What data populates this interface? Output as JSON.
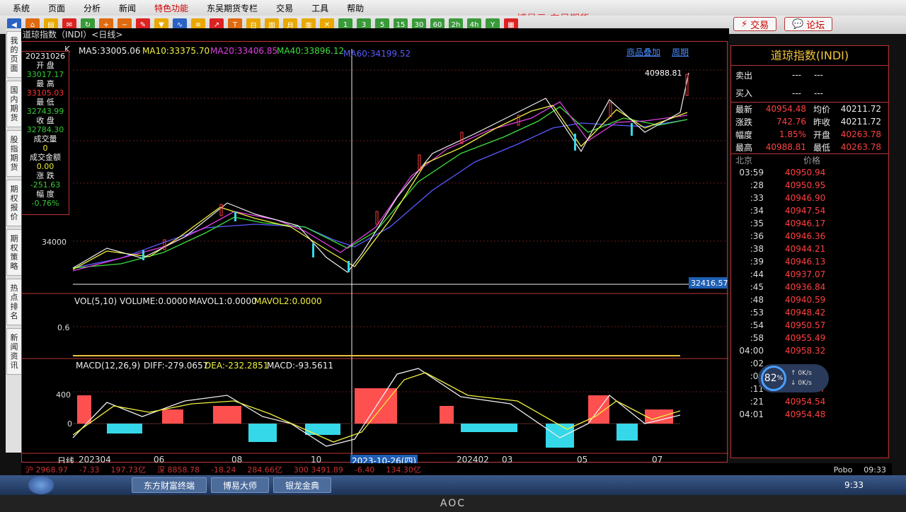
{
  "menu": {
    "items": [
      "系统",
      "页面",
      "分析",
      "新闻",
      "特色功能",
      "东吴期货专栏",
      "交易",
      "工具",
      "帮助"
    ],
    "highlight_index": 4
  },
  "brand": "博易云-东吴期货",
  "header_buttons": {
    "trade": "交易",
    "forum": "论坛"
  },
  "side_tabs": [
    "我的页面",
    "国内期货",
    "股指期货",
    "期权报价",
    "期权策略",
    "热点排名",
    "新闻资讯"
  ],
  "chart_title": "道琼指数（INDI）<日线>",
  "price_panel": {
    "date": "20231026",
    "fields": [
      {
        "label": "开 盘",
        "value": "33017.17",
        "color": "g"
      },
      {
        "label": "最 高",
        "value": "33105.03",
        "color": "r"
      },
      {
        "label": "最 低",
        "value": "32743.99",
        "color": "g"
      },
      {
        "label": "收 盘",
        "value": "32784.30",
        "color": "g"
      },
      {
        "label": "成交量",
        "value": "0",
        "color": "y"
      },
      {
        "label": "成交金额",
        "value": "0.00",
        "color": "y"
      },
      {
        "label": "涨 跌",
        "value": "-251.63",
        "color": "g"
      },
      {
        "label": "幅 度",
        "value": "-0.76%",
        "color": "g"
      }
    ]
  },
  "ma_legend": {
    "k": "K",
    "ma5": "MA5:33005.06",
    "ma10": "MA10:33375.70",
    "ma20": "MA20:33406.85",
    "ma40": "MA40:33896.12",
    "ma60": "MA60:34199.52",
    "overlay_link": "商品叠加",
    "period_link": "周期"
  },
  "price_labels": {
    "max": "40988.81",
    "crosshair_value": "32416.57",
    "y_tick": "34000"
  },
  "volume": {
    "legend": "VOL(5,10) VOLUME:0.0000",
    "mavol1": "MAVOL1:0.0000",
    "mavol2": "MAVOL2:0.0000",
    "y_tick": "0.6"
  },
  "macd": {
    "legend": "MACD(12,26,9)",
    "diff": "DIFF:-279.0657",
    "dea": "DEA:-232.2851",
    "macd": "MACD:-93.5611",
    "y_ticks": [
      "400",
      "0"
    ]
  },
  "x_axis": {
    "label": "日线",
    "ticks": [
      "202304",
      "06",
      "08",
      "10",
      "2023-10-26(四)",
      "202402",
      "03",
      "05",
      "07"
    ]
  },
  "right_panel": {
    "title": "道琼指数(INDI)",
    "sell_label": "卖出",
    "buy_label": "买入",
    "empty": "---",
    "stats": [
      {
        "l1": "最新",
        "v1": "40954.48",
        "l2": "均价",
        "v2": "40211.72"
      },
      {
        "l1": "涨跌",
        "v1": "742.76",
        "l2": "昨收",
        "v2": "40211.72"
      },
      {
        "l1": "幅度",
        "v1": "1.85%",
        "l2": "开盘",
        "v2": "40263.78"
      },
      {
        "l1": "最高",
        "v1": "40988.81",
        "l2": "最低",
        "v2": "40263.78"
      }
    ],
    "tick_header": {
      "city": "北京",
      "price": "价格"
    },
    "ticks": [
      {
        "t": "03:59",
        "p": "40950.94"
      },
      {
        "t": ":28",
        "p": "40950.95"
      },
      {
        "t": ":33",
        "p": "40946.90"
      },
      {
        "t": ":34",
        "p": "40947.54"
      },
      {
        "t": ":35",
        "p": "40946.17"
      },
      {
        "t": ":36",
        "p": "40946.36"
      },
      {
        "t": ":38",
        "p": "40944.21"
      },
      {
        "t": ":39",
        "p": "40946.13"
      },
      {
        "t": ":44",
        "p": "40937.07"
      },
      {
        "t": ":45",
        "p": "40936.84"
      },
      {
        "t": ":48",
        "p": "40940.59"
      },
      {
        "t": ":53",
        "p": "40948.42"
      },
      {
        "t": ":54",
        "p": "40950.57"
      },
      {
        "t": ":58",
        "p": "40955.49"
      },
      {
        "t": "04:00",
        "p": "40958.32"
      },
      {
        "t": ":02",
        "p": ""
      },
      {
        "t": ":03",
        "p": ""
      },
      {
        "t": ":11",
        "p": "40955.07"
      },
      {
        "t": ":21",
        "p": "40954.54"
      },
      {
        "t": "04:01",
        "p": "40954.48"
      }
    ],
    "net_widget": {
      "percent": "82",
      "unit": "%",
      "up": "0K/s",
      "down": "0K/s"
    }
  },
  "status_bar": [
    "沪 2968.97",
    "-7.33",
    "197.73亿",
    "深 8858.78",
    "-18.24",
    "284.66亿",
    "300 3491.89",
    "-6.40",
    "134.30亿"
  ],
  "pobo": "Pobo",
  "clock": "09:33",
  "taskbar": {
    "items": [
      "东方财富终端",
      "博易大师",
      "银龙金典"
    ],
    "time": "9:33"
  },
  "monitor_brand": "AOC"
}
